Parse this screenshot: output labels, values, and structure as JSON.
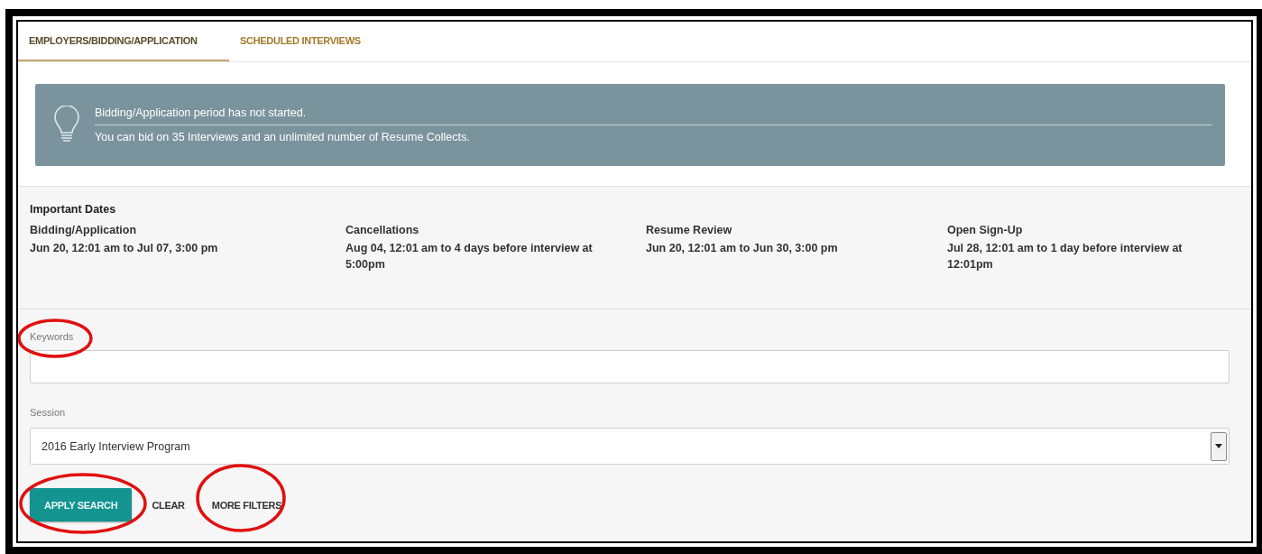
{
  "tabs": [
    {
      "label": "EMPLOYERS/BIDDING/APPLICATION",
      "selected": true
    },
    {
      "label": "SCHEDULED INTERVIEWS",
      "selected": false
    }
  ],
  "alert": {
    "message": "Bidding/Application period has not started.",
    "detail": "You can bid on 35 Interviews and an unlimited number of Resume Collects."
  },
  "important_dates": {
    "title": "Important Dates",
    "items": [
      {
        "label": "Bidding/Application",
        "value": "Jun 20, 12:01 am to Jul 07, 3:00 pm"
      },
      {
        "label": "Cancellations",
        "value": "Aug 04, 12:01 am to 4 days before interview at 5:00pm"
      },
      {
        "label": "Resume Review",
        "value": "Jun 20, 12:01 am to Jun 30, 3:00 pm"
      },
      {
        "label": "Open Sign-Up",
        "value": "Jul 28, 12:01 am to 1 day before interview at 12:01pm"
      }
    ]
  },
  "search": {
    "fields": [
      {
        "kind": "text",
        "label": "Keywords",
        "highlighted": true
      },
      {
        "kind": "select",
        "label": "Session",
        "value": "2016 Early Interview Program",
        "highlighted": false
      }
    ],
    "buttons": [
      {
        "kind": "primary",
        "label": "APPLY SEARCH",
        "highlighted": true
      },
      {
        "kind": "flat",
        "label": "CLEAR",
        "highlighted": false
      },
      {
        "kind": "flat",
        "label": "MORE FILTERS",
        "highlighted": true
      }
    ]
  }
}
